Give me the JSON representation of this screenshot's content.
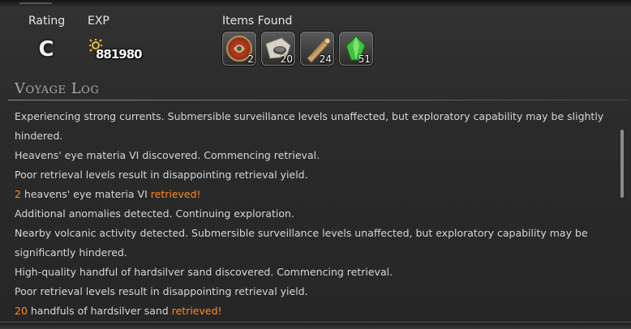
{
  "header": {
    "rating_label": "Rating",
    "rating_value": "C",
    "exp_label": "EXP",
    "exp_value": "881980",
    "items_label": "Items Found"
  },
  "items": [
    {
      "name": "heavens-eye-materia-vi",
      "count": "2",
      "icon": "materia-orb-icon"
    },
    {
      "name": "hardsilver-sand",
      "count": "20",
      "icon": "sand-pile-icon"
    },
    {
      "name": "lumber-log",
      "count": "24",
      "icon": "log-icon"
    },
    {
      "name": "green-crystal",
      "count": "51",
      "icon": "crystal-icon"
    }
  ],
  "voyage_log": {
    "title": "Voyage Log",
    "lines": [
      {
        "parts": [
          {
            "text": "Experiencing strong currents. Submersible surveillance levels unaffected, but exploratory capability may be slightly"
          }
        ]
      },
      {
        "parts": [
          {
            "text": "hindered."
          }
        ]
      },
      {
        "parts": [
          {
            "text": "Heavens' eye materia VI discovered. Commencing retrieval."
          }
        ]
      },
      {
        "parts": [
          {
            "text": "Poor retrieval levels result in disappointing retrieval yield."
          }
        ]
      },
      {
        "parts": [
          {
            "text": "2",
            "style": "num"
          },
          {
            "text": " heavens' eye materia VI "
          },
          {
            "text": "retrieved!",
            "style": "hl"
          }
        ]
      },
      {
        "parts": [
          {
            "text": "Additional anomalies detected. Continuing exploration."
          }
        ]
      },
      {
        "parts": [
          {
            "text": "Nearby volcanic activity detected. Submersible surveillance levels unaffected, but exploratory capability may be"
          }
        ]
      },
      {
        "parts": [
          {
            "text": "significantly hindered."
          }
        ]
      },
      {
        "parts": [
          {
            "text": "High-quality handful of hardsilver sand discovered. Commencing retrieval."
          }
        ]
      },
      {
        "parts": [
          {
            "text": "Poor retrieval levels result in disappointing retrieval yield."
          }
        ]
      },
      {
        "parts": [
          {
            "text": "20",
            "style": "num"
          },
          {
            "text": " handfuls of hardsilver sand "
          },
          {
            "text": "retrieved!",
            "style": "hl"
          }
        ]
      }
    ]
  },
  "colors": {
    "highlight": "#ff8a1e",
    "text": "#d6d6d6",
    "background": "#2b2b2b"
  }
}
